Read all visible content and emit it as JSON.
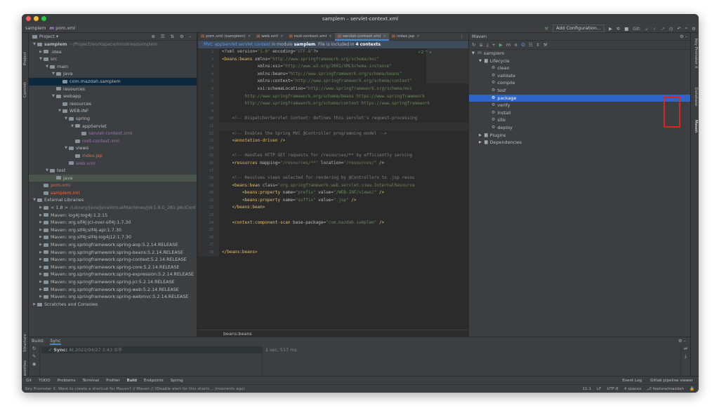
{
  "window": {
    "title": "samplem – servlet-context.xml"
  },
  "nav": {
    "project": "samplem",
    "file": "pom.xml",
    "config_button": "Add Configuration...",
    "git_label": "Git:"
  },
  "left_strip": {
    "project": "Project",
    "commit": "Commit",
    "structure": "Structure",
    "favorites": "Favorites"
  },
  "right_strip": {
    "key_promoter": "Key Promoter X",
    "database": "Database",
    "maven": "Maven"
  },
  "project_panel": {
    "title": "Project",
    "tree": [
      {
        "indent": 0,
        "arrow": "v",
        "label": "samplem",
        "extra": "~/Project/workspace/innotree/samplem",
        "cls": "bold"
      },
      {
        "indent": 1,
        "arrow": ">",
        "label": ".idea"
      },
      {
        "indent": 1,
        "arrow": "v",
        "label": "src"
      },
      {
        "indent": 2,
        "arrow": "v",
        "label": "main"
      },
      {
        "indent": 3,
        "arrow": "v",
        "label": "java"
      },
      {
        "indent": 4,
        "arrow": "",
        "label": "com.mazdah.samplem",
        "cls": "sel"
      },
      {
        "indent": 3,
        "arrow": "",
        "label": "resources"
      },
      {
        "indent": 3,
        "arrow": "v",
        "label": "webapp"
      },
      {
        "indent": 4,
        "arrow": "",
        "label": "resources"
      },
      {
        "indent": 4,
        "arrow": "v",
        "label": "WEB-INF"
      },
      {
        "indent": 5,
        "arrow": "v",
        "label": "spring"
      },
      {
        "indent": 6,
        "arrow": "v",
        "label": "appServlet"
      },
      {
        "indent": 7,
        "arrow": "",
        "label": "servlet-context.xml",
        "cls": "xml"
      },
      {
        "indent": 6,
        "arrow": "",
        "label": "root-context.xml",
        "cls": "xml"
      },
      {
        "indent": 5,
        "arrow": "v",
        "label": "views"
      },
      {
        "indent": 6,
        "arrow": "",
        "label": "index.jsp",
        "cls": "orng"
      },
      {
        "indent": 5,
        "arrow": "",
        "label": "web.xml",
        "cls": "xml"
      },
      {
        "indent": 2,
        "arrow": "v",
        "label": "test"
      },
      {
        "indent": 3,
        "arrow": "",
        "label": "java",
        "cls": "gr"
      },
      {
        "indent": 1,
        "arrow": "",
        "label": "pom.xml",
        "cls": "orng"
      },
      {
        "indent": 1,
        "arrow": "",
        "label": "samplem.iml",
        "cls": "orng"
      },
      {
        "indent": 0,
        "arrow": "v",
        "label": "External Libraries"
      },
      {
        "indent": 1,
        "arrow": ">",
        "label": "< 1.8 >",
        "extra": "/Library/Java/JavaVirtualMachines/jdk1.8.0_281.jdk/Cont"
      },
      {
        "indent": 1,
        "arrow": ">",
        "label": "Maven: log4j:log4j:1.2.15"
      },
      {
        "indent": 1,
        "arrow": ">",
        "label": "Maven: org.slf4j:jcl-over-slf4j:1.7.30"
      },
      {
        "indent": 1,
        "arrow": ">",
        "label": "Maven: org.slf4j:slf4j-api:1.7.30"
      },
      {
        "indent": 1,
        "arrow": ">",
        "label": "Maven: org.slf4j:slf4j-log4j12:1.7.30"
      },
      {
        "indent": 1,
        "arrow": ">",
        "label": "Maven: org.springframework:spring-aop:5.2.14.RELEASE"
      },
      {
        "indent": 1,
        "arrow": ">",
        "label": "Maven: org.springframework:spring-beans:5.2.14.RELEASE"
      },
      {
        "indent": 1,
        "arrow": ">",
        "label": "Maven: org.springframework:spring-context:5.2.14.RELEASE"
      },
      {
        "indent": 1,
        "arrow": ">",
        "label": "Maven: org.springframework:spring-core:5.2.14.RELEASE"
      },
      {
        "indent": 1,
        "arrow": ">",
        "label": "Maven: org.springframework:spring-expression:5.2.14.RELEASE"
      },
      {
        "indent": 1,
        "arrow": ">",
        "label": "Maven: org.springframework:spring-jcl:5.2.14.RELEASE"
      },
      {
        "indent": 1,
        "arrow": ">",
        "label": "Maven: org.springframework:spring-web:5.2.14.RELEASE"
      },
      {
        "indent": 1,
        "arrow": ">",
        "label": "Maven: org.springframework:spring-webmvc:5.2.14.RELEASE"
      },
      {
        "indent": 0,
        "arrow": ">",
        "label": "Scratches and Consoles"
      }
    ]
  },
  "editor": {
    "tabs": [
      {
        "label": "pom.xml (samplem)",
        "active": false
      },
      {
        "label": "web.xml",
        "active": false
      },
      {
        "label": "root-context.xml",
        "active": false
      },
      {
        "label": "servlet-context.xml",
        "active": true
      },
      {
        "label": "index.jsp",
        "active": false
      }
    ],
    "banner": {
      "context": "MVC appServlet servlet context",
      "pre": "in module",
      "module": "samplem",
      "mid": ". File is included in",
      "count": "4 contexts",
      "end": "."
    },
    "inspection": "✓2 ^ v",
    "breadcrumb": "beans:beans",
    "lines": [
      {
        "n": "1",
        "html": "<span class='a'>&lt;?xml version=</span><span class='v'>\"1.0\"</span><span class='a'> encoding=</span><span class='v'>\"UTF-8\"</span><span class='a'>?&gt;</span>"
      },
      {
        "n": "2",
        "html": "<span class='t'>&lt;beans:beans </span><span class='a'>xmlns=</span><span class='v'>\"http://www.springframework.org/schema/mvc\"</span>"
      },
      {
        "n": "3",
        "html": "              <span class='a'>xmlns:xsi=</span><span class='v'>\"http://www.w3.org/2001/XMLSchema-instance\"</span>"
      },
      {
        "n": "4",
        "html": "              <span class='a'>xmlns:beans=</span><span class='v'>\"http://www.springframework.org/schema/beans\"</span>"
      },
      {
        "n": "5",
        "html": "              <span class='a'>xmlns:context=</span><span class='v'>\"http://www.springframework.org/schema/context\"</span>"
      },
      {
        "n": "6",
        "html": "              <span class='a'>xsi:schemaLocation=</span><span class='v'>\"http://www.springframework.org/schema/mvc</span>"
      },
      {
        "n": "7",
        "html": "<span class='v'>         http://www.springframework.org/schema/beans https://www.springframework</span>"
      },
      {
        "n": "8",
        "html": "<span class='v'>         http://www.springframework.org/schema/context https://www.springframework</span>"
      },
      {
        "n": "9",
        "html": ""
      },
      {
        "n": "10",
        "html": "    <span class='c'>&lt;!-- DispatcherServlet Context: defines this servlet's request-processing</span>"
      },
      {
        "n": "11",
        "html": "",
        "cur": true
      },
      {
        "n": "12",
        "html": "    <span class='c'>&lt;!-- Enables the Spring MVC @Controller programming model --&gt;</span>"
      },
      {
        "n": "13",
        "html": "    <span class='t'>&lt;annotation-driven /&gt;</span>"
      },
      {
        "n": "14",
        "html": ""
      },
      {
        "n": "15",
        "html": "    <span class='c'>&lt;!-- Handles HTTP GET requests for /resources/** by efficiently serving</span>"
      },
      {
        "n": "16",
        "html": "    <span class='t'>&lt;resources </span><span class='a'>mapping=</span><span class='v'>\"/resources/**\"</span><span class='a'> location=</span><span class='v'>\"/resources/\"</span><span class='t'> /&gt;</span>"
      },
      {
        "n": "17",
        "html": ""
      },
      {
        "n": "18",
        "html": "    <span class='c'>&lt;!-- Resolves views selected for rendering by @Controllers to .jsp resou</span>"
      },
      {
        "n": "19",
        "html": "    <span class='t'>&lt;beans:bean </span><span class='a'>class=</span><span class='v'>\"org.springframework.web.servlet.view.InternalResource</span>"
      },
      {
        "n": "20",
        "html": "        <span class='t'>&lt;beans:property </span><span class='a'>name=</span><span class='v'>\"prefix\"</span><span class='a'> value=</span><span class='v'>\"/WEB-INF/views/\"</span><span class='t'> /&gt;</span>"
      },
      {
        "n": "21",
        "html": "        <span class='t'>&lt;beans:property </span><span class='a'>name=</span><span class='v'>\"suffix\"</span><span class='a'> value=</span><span class='v'>\".jsp\"</span><span class='t'> /&gt;</span>"
      },
      {
        "n": "22",
        "html": "    <span class='t'>&lt;/beans:bean&gt;</span>"
      },
      {
        "n": "23",
        "html": ""
      },
      {
        "n": "24",
        "html": "    <span class='t'>&lt;context:component-scan </span><span class='a'>base-package=</span><span class='v'>\"com.mazdah.samplem\"</span><span class='t'> /&gt;</span>"
      },
      {
        "n": "25",
        "html": ""
      },
      {
        "n": "26",
        "html": ""
      },
      {
        "n": "27",
        "html": ""
      },
      {
        "n": "28",
        "html": "<span class='t'>&lt;/beans:beans&gt;</span>"
      }
    ]
  },
  "maven": {
    "title": "Maven",
    "tree": [
      {
        "indent": 0,
        "arrow": "v",
        "label": "samplem",
        "icon": "m"
      },
      {
        "indent": 1,
        "arrow": "v",
        "label": "Lifecycle",
        "icon": "f"
      },
      {
        "indent": 2,
        "arrow": "",
        "label": "clean",
        "icon": "g"
      },
      {
        "indent": 2,
        "arrow": "",
        "label": "validate",
        "icon": "g"
      },
      {
        "indent": 2,
        "arrow": "",
        "label": "compile",
        "icon": "g"
      },
      {
        "indent": 2,
        "arrow": "",
        "label": "test",
        "icon": "g"
      },
      {
        "indent": 2,
        "arrow": "",
        "label": "package",
        "icon": "g",
        "sel": true
      },
      {
        "indent": 2,
        "arrow": "",
        "label": "verify",
        "icon": "g"
      },
      {
        "indent": 2,
        "arrow": "",
        "label": "install",
        "icon": "g"
      },
      {
        "indent": 2,
        "arrow": "",
        "label": "site",
        "icon": "g"
      },
      {
        "indent": 2,
        "arrow": "",
        "label": "deploy",
        "icon": "g"
      },
      {
        "indent": 1,
        "arrow": ">",
        "label": "Plugins",
        "icon": "f"
      },
      {
        "indent": 1,
        "arrow": ">",
        "label": "Dependencies",
        "icon": "f"
      }
    ]
  },
  "build": {
    "label": "Build:",
    "tab": "Sync",
    "row_status": "Sync:",
    "row_time": "At 2021/04/27 2:43 오후",
    "duration": "1 sec, 517 ms"
  },
  "bottom_tools": {
    "items": [
      "Git",
      "TODO",
      "Problems",
      "Terminal",
      "Profiler",
      "Build",
      "Endpoints",
      "Spring"
    ],
    "active": "Build",
    "right": [
      "Event Log",
      "Gitlab pipeline viewer"
    ]
  },
  "status": {
    "message": "Key Promoter X: Want to create a shortcut for Maven? // Maven // (Disable alert for this shortc... (moments ago)",
    "position": "11:1",
    "line_sep": "LF",
    "encoding": "UTF-8",
    "indent": "4 spaces",
    "branch": "feature/mazdah"
  },
  "colors": {
    "accent": "#4a88c7",
    "selection": "#2f65ca",
    "highlight": "#e0231c"
  }
}
